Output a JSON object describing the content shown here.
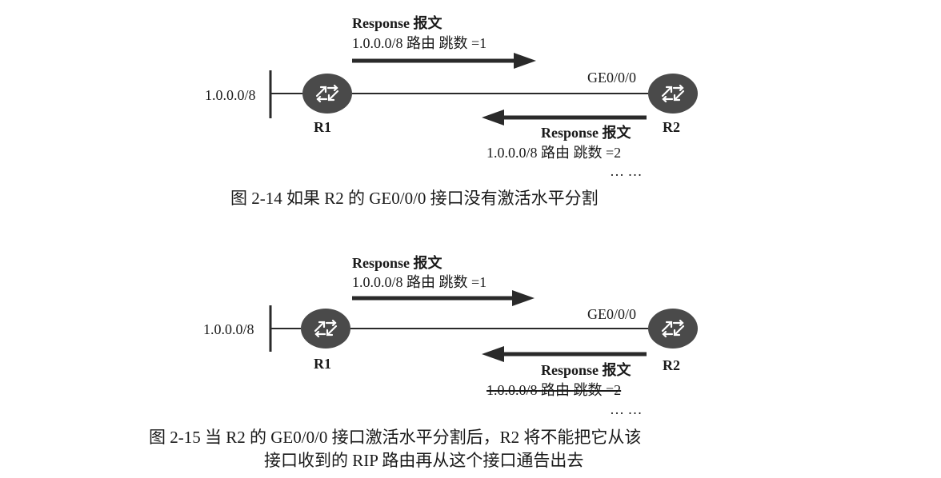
{
  "figure1": {
    "msg_top_title": "Response 报文",
    "msg_top_route": "1.0.0.0/8 路由  跳数 =1",
    "net_label": "1.0.0.0/8",
    "r1_label": "R1",
    "r2_label": "R2",
    "iface_label": "GE0/0/0",
    "msg_bottom_title": "Response 报文",
    "msg_bottom_route": "1.0.0.0/8 路由  跳数 =2",
    "ellipsis": "… …",
    "caption": "图 2-14    如果 R2 的 GE0/0/0 接口没有激活水平分割"
  },
  "figure2": {
    "msg_top_title": "Response 报文",
    "msg_top_route": "1.0.0.0/8 路由  跳数 =1",
    "net_label": "1.0.0.0/8",
    "r1_label": "R1",
    "r2_label": "R2",
    "iface_label": "GE0/0/0",
    "msg_bottom_title": "Response 报文",
    "msg_bottom_route": "1.0.0.0/8 路由  跳数 =2",
    "ellipsis": "… …",
    "caption_line1": "图 2-15    当 R2 的 GE0/0/0 接口激活水平分割后，R2 将不能把它从该",
    "caption_line2": "接口收到的 RIP 路由再从这个接口通告出去"
  },
  "colors": {
    "router_fill": "#4a4a4a",
    "line": "#2a2a2a",
    "text": "#1a1a1a"
  },
  "icons": [
    "router-icon"
  ]
}
